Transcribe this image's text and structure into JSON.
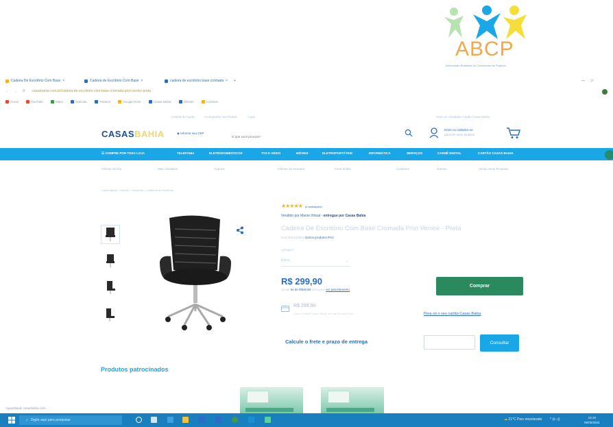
{
  "logo": {
    "text": "ABCP",
    "subtitle": "Associação Brasileira de Consultores de Projetos"
  },
  "browser": {
    "tabs": [
      {
        "label": "Cadeira De Escritório Com Base"
      },
      {
        "label": "Cadeira de Escritório Com Base"
      },
      {
        "label": "cadeira de escritório base cromada"
      }
    ],
    "address": "casasbahia.com.br/cadeira-de-escritorio-com-base-cromada-prizi-venice-preta",
    "bookmarks": [
      "Gmail",
      "YouTube",
      "Maps",
      "Notícias",
      "Traduzir",
      "Google Drive",
      "Casas Bahia",
      "Ofertas",
      "Correios"
    ],
    "status": "Aguardando casasbahia.com..."
  },
  "header": {
    "top_links": [
      "Central de Ajuda",
      "Acompanhe seu Pedido",
      "Lojas"
    ],
    "right_links": "Seja um Vendedor   Cartão Casas Bahia",
    "brand_a": "CASAS",
    "brand_b": "BAHIA",
    "cep": "Informe seu CEP",
    "search_placeholder": "O que você procura?",
    "login_line1": "Entre ou cadastre-se",
    "login_line2": "para ver seus pedidos"
  },
  "nav": {
    "items": [
      "COMPRE POR TODA LOJA",
      "TELEFONIA",
      "ELETRODOMÉSTICOS",
      "TVS E VÍDEO",
      "MÓVEIS",
      "ELETROPORTÁTEIS",
      "INFORMÁTICA",
      "SERVIÇOS",
      "CARNÊ DIGITAL",
      "CARTÃO CASAS BAHIA"
    ],
    "sub": [
      "Ofertas do Dia",
      "Mais Vendidos",
      "Cupons",
      "Ofertas da Semana",
      "Frete Grátis",
      "Celulares",
      "Games",
      "Venda Seus Produtos"
    ]
  },
  "breadcrumb": "Casas Bahia  >  Móveis  >  Escritório  >  Cadeiras de Escritório",
  "product": {
    "stars": "★★★★★",
    "reviews": "(6 avaliações)",
    "seller_prefix": "Vendido por Mania Virtual -",
    "seller_delivery": "entregue por Casas Bahia",
    "title": "Cadeira De Escritório Com Base Cromada Prizi Venice - Preta",
    "code_prefix": "Cód. 55012345  |",
    "code_link": "Outros produtos Prizi",
    "voltage_label": "Voltagem",
    "voltage_value": "Única",
    "price": "R$ 299,90",
    "installments_a": "ou até",
    "installments_b": "6x de R$49,98",
    "installments_c": "sem juros",
    "installments_link": "ver parcelamento",
    "buy_label": "Comprar",
    "card_price": "R$ 299,90",
    "card_text": "Com o Cartão Casas Bahia, em até 6x sem juros",
    "card_link": "Pera só o seu cartão Casas Bahia",
    "freight_label": "Calcule o frete e prazo de entrega",
    "cep_placeholder": "",
    "consult_label": "Consultar"
  },
  "sponsored": {
    "title": "Produtos patrocinados"
  },
  "taskbar": {
    "search": "Digite aqui para pesquisar",
    "weather": "21°C  Parc ensolarado",
    "time": "19:19",
    "date": "09/05/2022"
  },
  "colors": {
    "brand_blue": "#1d4d9e",
    "nav": "#1aa7e8",
    "buy": "#2a8a5e",
    "taskbar": "#1a7fbf"
  }
}
